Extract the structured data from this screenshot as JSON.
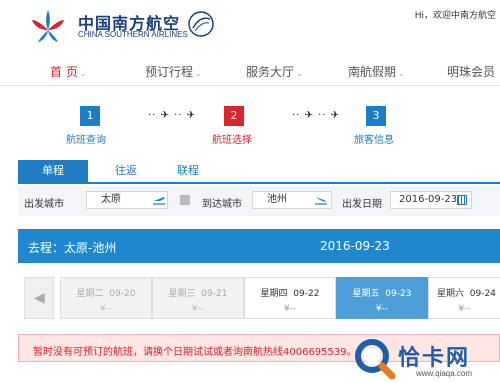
{
  "header": {
    "logo_cn": "中国南方航空",
    "logo_en": "CHINA SOUTHERN AIRLINES",
    "greeting": "Hi，欢迎中南方航空"
  },
  "nav": {
    "items": [
      {
        "label": "首 页",
        "active": true
      },
      {
        "label": "预订行程"
      },
      {
        "label": "服务大厅"
      },
      {
        "label": "南航假期"
      },
      {
        "label": "明珠会员"
      }
    ],
    "chevron": "⌄"
  },
  "steps": [
    {
      "number": "1",
      "label": "航班查询"
    },
    {
      "number": "2",
      "label": "航班选择"
    },
    {
      "number": "3",
      "label": "旅客信息"
    }
  ],
  "step_arrows": "·· ✈ ·· ✈",
  "trip_tabs": [
    "单程",
    "往返",
    "联程"
  ],
  "search": {
    "from_label": "出发城市",
    "from_value": "太原",
    "to_label": "到达城市",
    "to_value": "池州",
    "date_label": "出发日期",
    "date_value": "2016-09-23"
  },
  "route": {
    "text": "去程：太原-池州",
    "date": "2016-09-23"
  },
  "dates": [
    {
      "day": "星期二",
      "date": "09-20",
      "price": "¥--",
      "state": "past"
    },
    {
      "day": "星期三",
      "date": "09-21",
      "price": "¥--",
      "state": "past"
    },
    {
      "day": "星期四",
      "date": "09-22",
      "price": "¥--",
      "state": "normal"
    },
    {
      "day": "星期五",
      "date": "09-23",
      "price": "¥--",
      "state": "selected"
    },
    {
      "day": "星期六",
      "date": "09-24",
      "price": "¥--",
      "state": "normal"
    }
  ],
  "notice": "暂时没有可预订的航班，请换个日期试试或者询南航热线4006695539。",
  "watermark": {
    "text": "恰卡网",
    "url": "www.qiaqa.com"
  },
  "colors": {
    "brand_blue": "#1e7dc3",
    "brand_red": "#d9232d",
    "route_bar": "#1d88cf",
    "selected_day": "#4e9fd8"
  },
  "icons": {
    "step_arrow": "airplane-icon",
    "from_city": "takeoff-icon",
    "to_city": "landing-icon",
    "date": "calendar-icon",
    "prev": "chevron-left-icon"
  }
}
